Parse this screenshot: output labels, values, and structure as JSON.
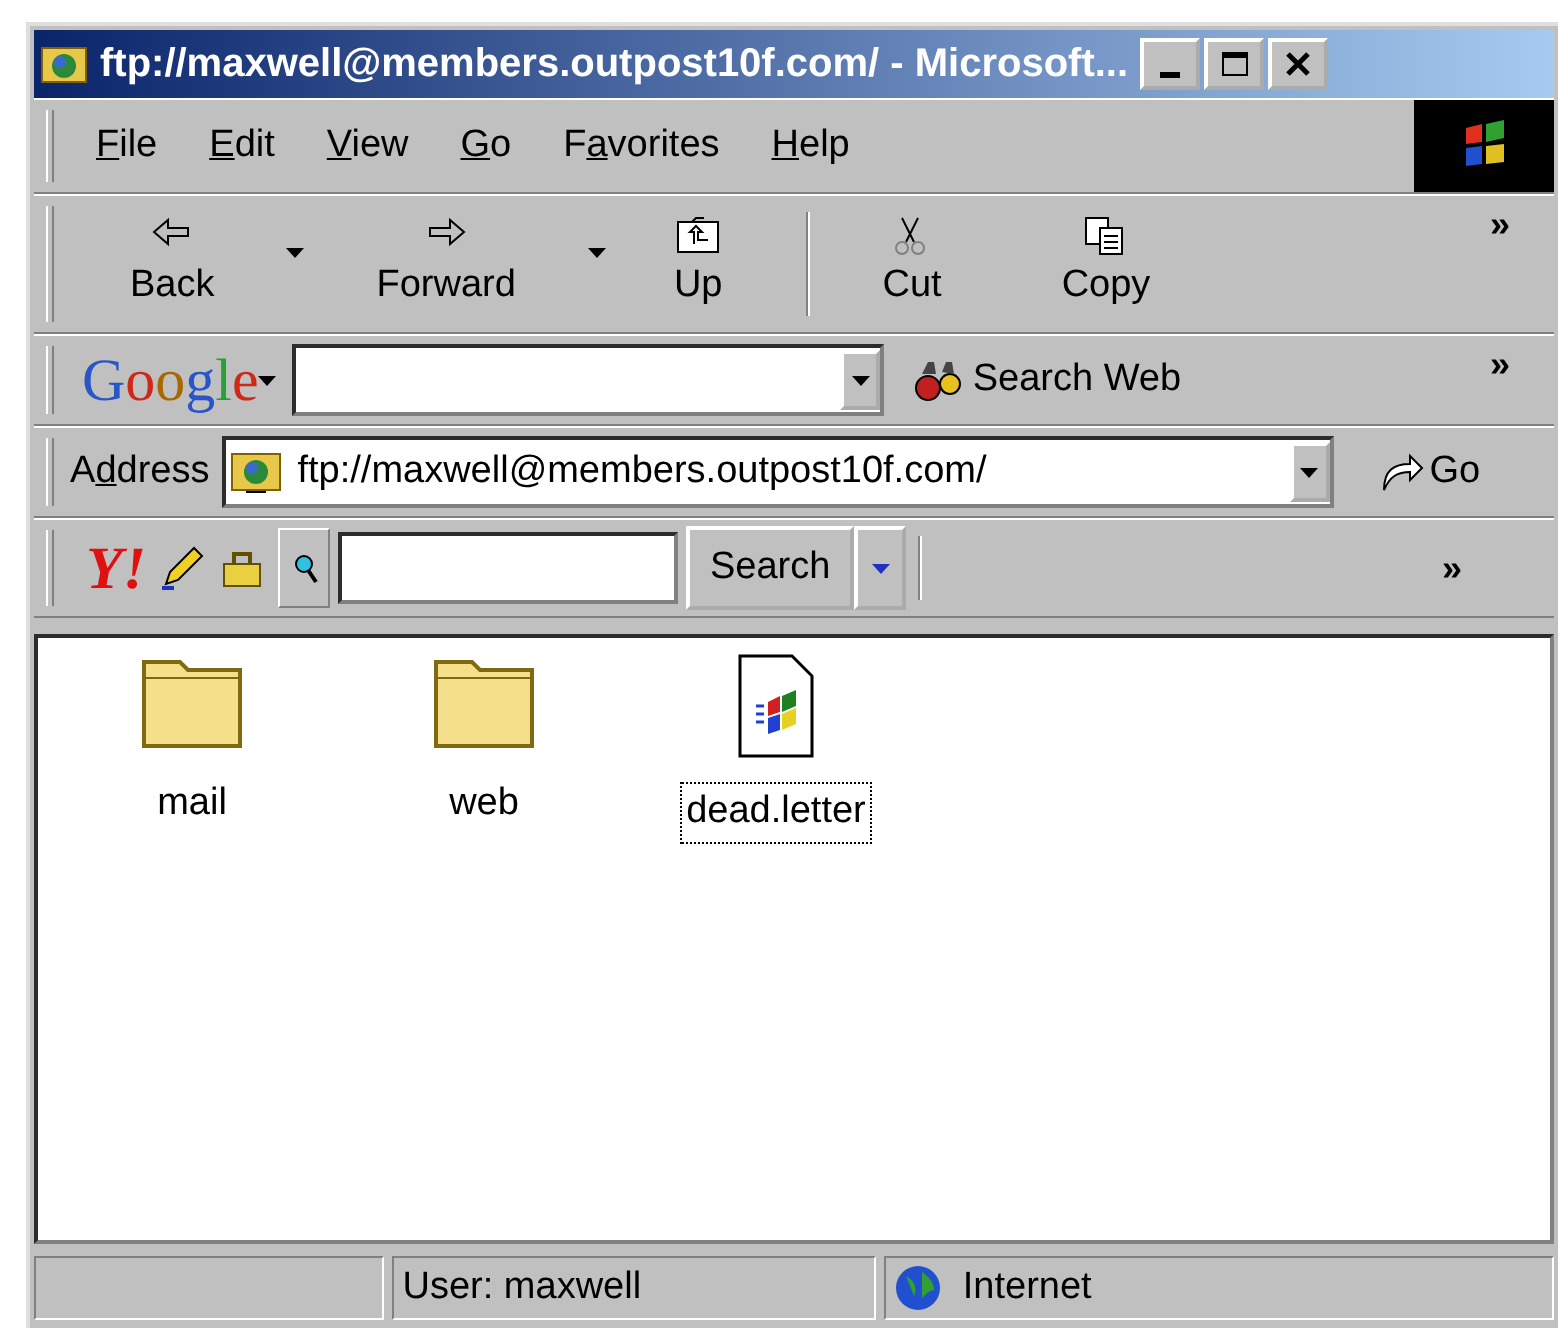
{
  "window": {
    "title": "ftp://maxwell@members.outpost10f.com/ - Microsoft..."
  },
  "menu": [
    {
      "key": "F",
      "after": "ile"
    },
    {
      "key": "E",
      "after": "dit"
    },
    {
      "key": "V",
      "after": "iew"
    },
    {
      "key": "G",
      "after": "o"
    },
    {
      "before": "F",
      "key": "a",
      "after": "vorites"
    },
    {
      "key": "H",
      "after": "elp"
    }
  ],
  "toolbar": {
    "buttons": [
      {
        "kind": "back",
        "label": "Back",
        "dropdown": true
      },
      {
        "kind": "forward",
        "label": "Forward",
        "dropdown": true
      },
      {
        "kind": "up",
        "label": "Up",
        "dropdown": false
      },
      {
        "kind": "cut",
        "label": "Cut",
        "dropdown": false
      },
      {
        "kind": "copy",
        "label": "Copy",
        "dropdown": false
      }
    ],
    "overflow": "»"
  },
  "google_bar": {
    "logo": "Google",
    "search_button": "Search Web",
    "overflow": "»"
  },
  "address_bar": {
    "label": {
      "before": "A",
      "key": "d",
      "after": "dress"
    },
    "value": "ftp://maxwell@members.outpost10f.com/",
    "go": "Go"
  },
  "yahoo_bar": {
    "logo": "Y!",
    "search_button": "Search",
    "overflow": "»"
  },
  "files": [
    {
      "kind": "folder",
      "name": "mail",
      "selected": false
    },
    {
      "kind": "folder",
      "name": "web",
      "selected": false
    },
    {
      "kind": "document",
      "name": "dead.letter",
      "selected": true
    }
  ],
  "status_bar": [
    {
      "kind": "text"
    },
    {
      "kind": "text",
      "text": "User: maxwell"
    },
    {
      "kind": "zone",
      "text": "Internet"
    }
  ]
}
